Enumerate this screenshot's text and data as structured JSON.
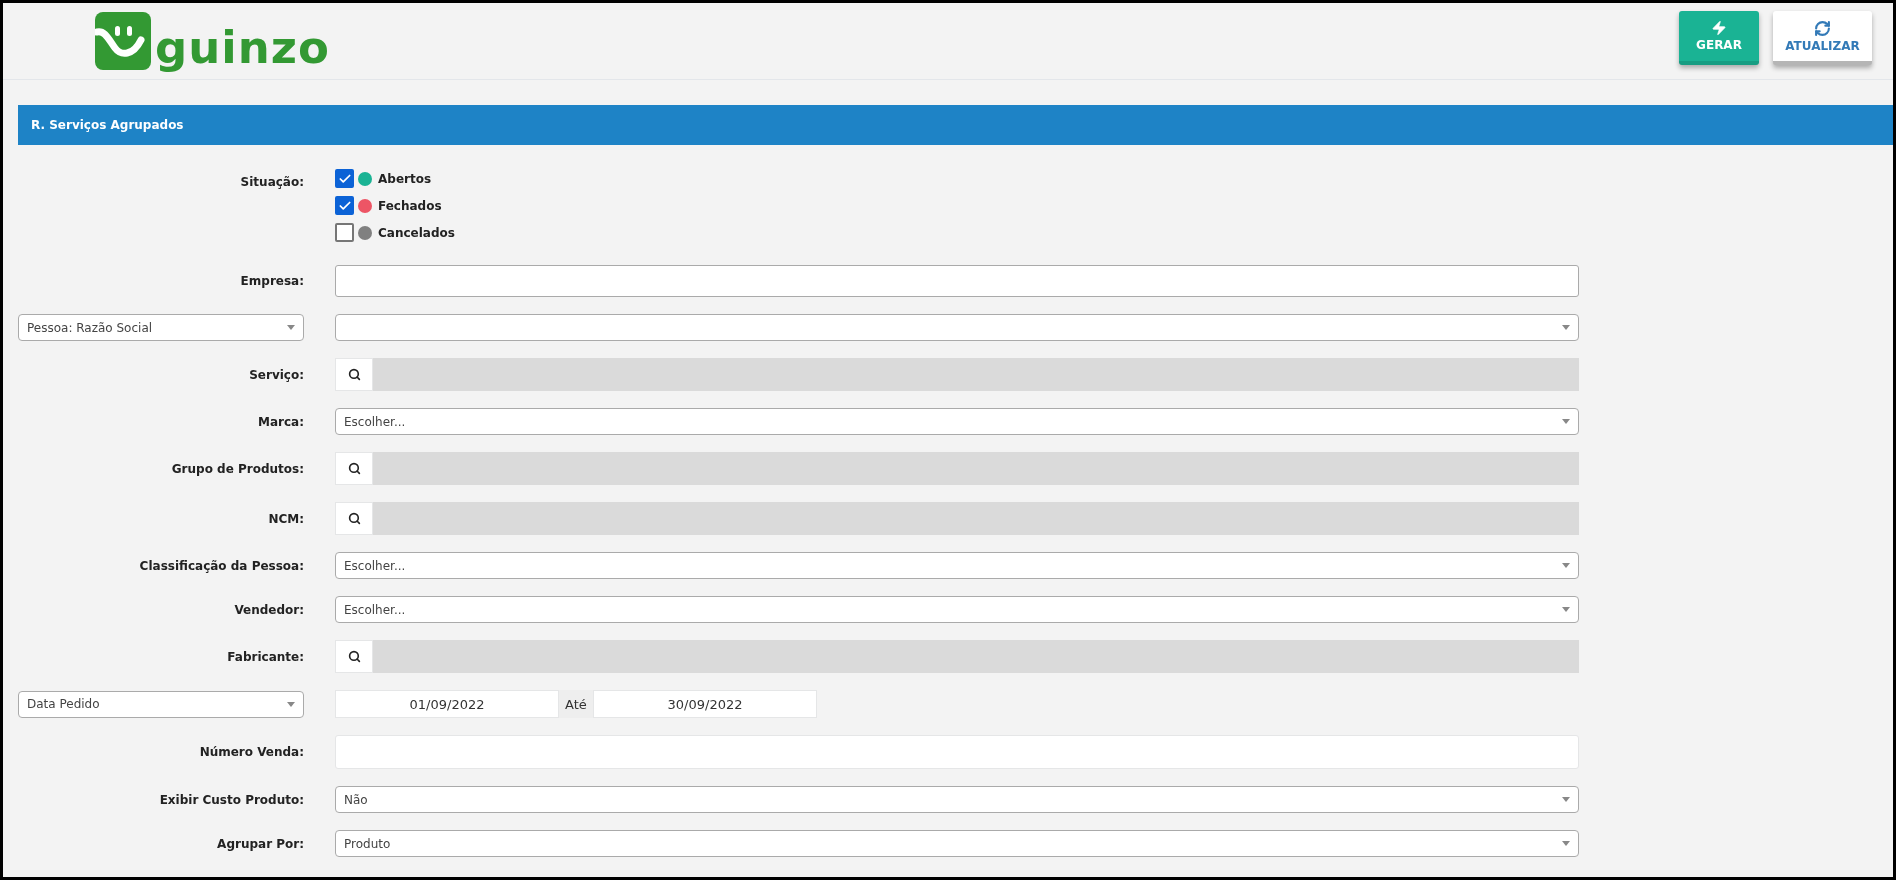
{
  "header": {
    "logo_text": "guinzo",
    "buttons": [
      {
        "label": "GERAR",
        "kind": "primary"
      },
      {
        "label": "ATUALIZAR",
        "kind": "secondary"
      }
    ]
  },
  "panel": {
    "title": "R. Serviços Agrupados"
  },
  "situacao": {
    "label": "Situação:",
    "options": [
      {
        "label": "Abertos",
        "checked": true,
        "color": "#1ab394"
      },
      {
        "label": "Fechados",
        "checked": true,
        "color": "#ed5565"
      },
      {
        "label": "Cancelados",
        "checked": false,
        "color": "#808080"
      }
    ]
  },
  "fields": [
    {
      "label": "Empresa:",
      "kind": "text"
    },
    {
      "selector": "Pessoa: Razão Social",
      "kind": "select"
    },
    {
      "label": "Serviço:",
      "kind": "lookup"
    },
    {
      "label": "Marca:",
      "kind": "select",
      "value": "Escolher..."
    },
    {
      "label": "Grupo de Produtos:",
      "kind": "lookup"
    },
    {
      "label": "NCM:",
      "kind": "lookup"
    },
    {
      "label": "Classificação da Pessoa:",
      "kind": "select",
      "value": "Escolher..."
    },
    {
      "label": "Vendedor:",
      "kind": "select",
      "value": "Escolher..."
    },
    {
      "label": "Fabricante:",
      "kind": "lookup"
    },
    {
      "selector": "Data Pedido",
      "kind": "daterange",
      "from": "01/09/2022",
      "separator": "Até",
      "to": "30/09/2022"
    },
    {
      "label": "Número Venda:",
      "kind": "text"
    },
    {
      "label": "Exibir Custo Produto:",
      "kind": "select",
      "value": "Não"
    },
    {
      "label": "Agrupar Por:",
      "kind": "select",
      "value": "Produto"
    }
  ]
}
